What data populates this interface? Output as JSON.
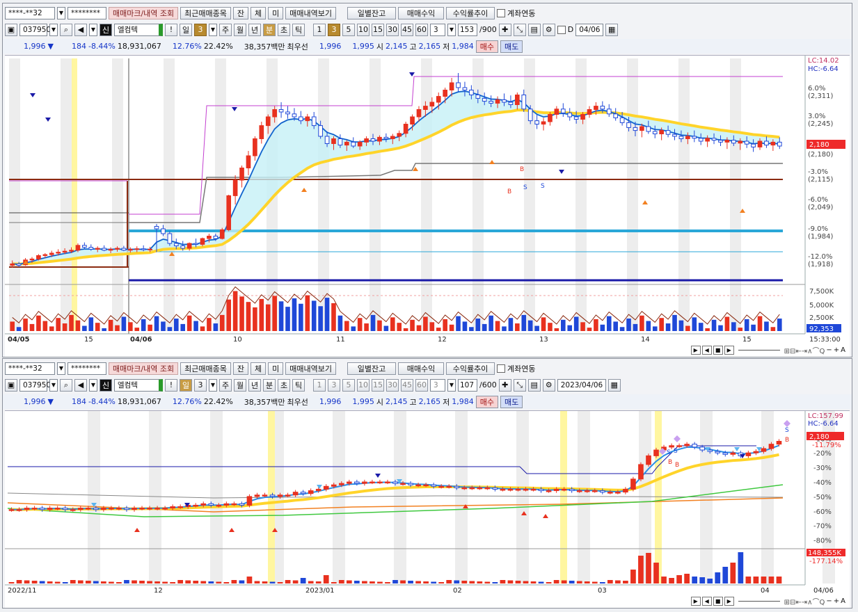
{
  "colors": {
    "up": "#e8311f",
    "down": "#1f48d8",
    "ma_yellow": "#ffd42a",
    "ma_blue": "#2a8fe6",
    "cloud": "#c6f0f6",
    "envelope": "#c33fd0",
    "pivot_cyan": "#2aa7d8",
    "navy": "#1a1aa8",
    "brown": "#8b2a10",
    "orange": "#f28020",
    "green": "#3fc83f",
    "gray": "#777777",
    "highlight": "#fff6a0",
    "price_tag": "#ee2a2a",
    "volume_tag": "#1f48d8"
  },
  "panel1": {
    "toolbar": {
      "account": "****-**32",
      "password": "********",
      "mark_btn": "매매마크/내역 조회",
      "recent_btn": "최근매매종목",
      "jan": "잔",
      "che": "체",
      "mi": "미",
      "history_btn": "매매내역보기",
      "daily_balance": "일별잔고",
      "trade_profit": "매매수익",
      "return_trend": "수익률추이",
      "link_account": "계좌연동"
    },
    "symbol_bar": {
      "code": "037950",
      "tag": "신",
      "name": "엘컴텍",
      "excl": "!",
      "periods": [
        "일",
        "3",
        "주",
        "월",
        "년",
        "분",
        "초",
        "틱"
      ],
      "intervals": [
        "1",
        "3",
        "5",
        "10",
        "15",
        "30",
        "45",
        "60"
      ],
      "interval_value": "3",
      "count": "153",
      "count_max": "/900",
      "d_label": "D",
      "date": "04/06"
    },
    "quote": {
      "price": "1,996",
      "change": "184",
      "rate": "-8.44%",
      "volume": "18,931,067",
      "turnover1": "12.76%",
      "turnover2": "22.42%",
      "amount": "38,357백만",
      "best_label": "최우선",
      "ask": "1,996",
      "bid": "1,995",
      "open_label": "시",
      "open": "2,145",
      "high_label": "고",
      "high": "2,165",
      "low_label": "저",
      "low": "1,984",
      "buy": "매수",
      "sell": "매도"
    },
    "axis": {
      "lc": "LC:14.02",
      "hc": "HC:-6.64",
      "price_labels": [
        {
          "pct": "6.0%",
          "price": "(2,311)"
        },
        {
          "pct": "3.0%",
          "price": "(2,245)"
        },
        {
          "pct": "-3.0%",
          "price": "(2,115)"
        },
        {
          "pct": "-6.0%",
          "price": "(2,049)"
        },
        {
          "pct": "-9.0%",
          "price": "(1,984)"
        },
        {
          "pct": "-12.0%",
          "price": "(1,918)"
        }
      ],
      "current_price": "2,180",
      "current_price2": "(2,180)",
      "volume_labels": [
        "7,500K",
        "5,000K",
        "2,500K"
      ],
      "current_volume": "92,353",
      "time_label": "15:33:00",
      "x_labels": [
        "04/05",
        "15",
        "04/06",
        "10",
        "11",
        "12",
        "13",
        "14",
        "15"
      ]
    }
  },
  "panel2": {
    "toolbar": {
      "account": "****-**32",
      "password": "********",
      "mark_btn": "매매마크/내역 조회",
      "recent_btn": "최근매매종목",
      "jan": "잔",
      "che": "체",
      "mi": "미",
      "history_btn": "매매내역보기",
      "daily_balance": "일별잔고",
      "trade_profit": "매매수익",
      "return_trend": "수익률추이",
      "link_account": "계좌연동"
    },
    "symbol_bar": {
      "code": "037950",
      "tag": "신",
      "name": "엘컴텍",
      "excl": "!",
      "periods": [
        "일",
        "3",
        "주",
        "월",
        "년",
        "분",
        "초",
        "틱"
      ],
      "intervals": [
        "1",
        "3",
        "5",
        "10",
        "15",
        "30",
        "45",
        "60"
      ],
      "interval_value": "3",
      "count": "107",
      "count_max": "/600",
      "date": "2023/04/06"
    },
    "quote": {
      "price": "1,996",
      "change": "184",
      "rate": "-8.44%",
      "volume": "18,931,067",
      "turnover1": "12.76%",
      "turnover2": "22.42%",
      "amount": "38,357백만",
      "best_label": "최우선",
      "ask": "1,996",
      "bid": "1,995",
      "open_label": "시",
      "open": "2,145",
      "high_label": "고",
      "high": "2,165",
      "low_label": "저",
      "low": "1,984",
      "buy": "매수",
      "sell": "매도"
    },
    "axis": {
      "lc": "LC:157.99",
      "hc": "HC:-6.64",
      "pct_labels": [
        "-10%",
        "-20%",
        "-30%",
        "-40%",
        "-50%",
        "-60%",
        "-70%",
        "-80%"
      ],
      "current_price": "2,180",
      "current_pct": "-11.79%",
      "current_volume": "148,355K",
      "volume_pct": "-177.14%",
      "x_labels": [
        "2022/11",
        "12",
        "2023/01",
        "02",
        "03",
        "04",
        "04/06"
      ]
    }
  },
  "chart_data": [
    {
      "type": "candlestick",
      "title": "엘컴텍 3분봉",
      "period": "3-minute",
      "x_labels": [
        "04/05",
        "15",
        "04/06",
        "10",
        "11",
        "12",
        "13",
        "14",
        "15"
      ],
      "price_range": [
        1900,
        2360
      ],
      "ohlc": [
        [
          1935,
          1945,
          1930,
          1938
        ],
        [
          1938,
          1942,
          1932,
          1935
        ],
        [
          1936,
          1950,
          1934,
          1946
        ],
        [
          1946,
          1952,
          1940,
          1948
        ],
        [
          1948,
          1958,
          1945,
          1955
        ],
        [
          1955,
          1960,
          1950,
          1957
        ],
        [
          1957,
          1965,
          1952,
          1960
        ],
        [
          1960,
          1968,
          1955,
          1962
        ],
        [
          1962,
          1970,
          1958,
          1964
        ],
        [
          1964,
          1972,
          1960,
          1966
        ],
        [
          1966,
          1980,
          1962,
          1976
        ],
        [
          1976,
          1982,
          1968,
          1972
        ],
        [
          1972,
          1978,
          1965,
          1968
        ],
        [
          1968,
          1974,
          1962,
          1970
        ],
        [
          1970,
          1976,
          1964,
          1966
        ],
        [
          1966,
          1972,
          1960,
          1968
        ],
        [
          1968,
          1974,
          1963,
          1970
        ],
        [
          1970,
          1975,
          1964,
          1966
        ],
        [
          1966,
          1972,
          1961,
          1968
        ],
        [
          1968,
          1974,
          1962,
          1969
        ],
        [
          1969,
          1976,
          1964,
          1967
        ],
        [
          1967,
          1973,
          1962,
          1968
        ],
        [
          2015,
          2020,
          1962,
          2010
        ],
        [
          2010,
          2018,
          1995,
          2000
        ],
        [
          2000,
          2005,
          1975,
          1980
        ],
        [
          1980,
          1990,
          1968,
          1975
        ],
        [
          1975,
          1985,
          1965,
          1970
        ],
        [
          1970,
          1982,
          1965,
          1980
        ],
        [
          1980,
          1990,
          1972,
          1978
        ],
        [
          1978,
          1992,
          1974,
          1990
        ],
        [
          1990,
          2000,
          1982,
          1995
        ],
        [
          1995,
          2000,
          1985,
          1990
        ],
        [
          1990,
          2012,
          1988,
          2008
        ],
        [
          2008,
          2080,
          2005,
          2078
        ],
        [
          2078,
          2120,
          2060,
          2110
        ],
        [
          2110,
          2140,
          2095,
          2135
        ],
        [
          2135,
          2170,
          2120,
          2160
        ],
        [
          2160,
          2200,
          2150,
          2195
        ],
        [
          2195,
          2230,
          2185,
          2222
        ],
        [
          2222,
          2245,
          2205,
          2240
        ],
        [
          2240,
          2262,
          2228,
          2255
        ],
        [
          2255,
          2270,
          2238,
          2250
        ],
        [
          2250,
          2262,
          2236,
          2246
        ],
        [
          2246,
          2258,
          2232,
          2240
        ],
        [
          2240,
          2252,
          2225,
          2232
        ],
        [
          2232,
          2246,
          2220,
          2240
        ],
        [
          2240,
          2250,
          2215,
          2222
        ],
        [
          2222,
          2232,
          2195,
          2200
        ],
        [
          2200,
          2210,
          2178,
          2185
        ],
        [
          2185,
          2200,
          2172,
          2195
        ],
        [
          2195,
          2204,
          2176,
          2182
        ],
        [
          2182,
          2192,
          2170,
          2188
        ],
        [
          2188,
          2198,
          2176,
          2180
        ],
        [
          2180,
          2192,
          2172,
          2188
        ],
        [
          2188,
          2200,
          2180,
          2195
        ],
        [
          2195,
          2205,
          2182,
          2190
        ],
        [
          2190,
          2202,
          2182,
          2198
        ],
        [
          2198,
          2206,
          2188,
          2195
        ],
        [
          2195,
          2205,
          2184,
          2200
        ],
        [
          2200,
          2212,
          2190,
          2206
        ],
        [
          2206,
          2230,
          2198,
          2225
        ],
        [
          2225,
          2245,
          2212,
          2240
        ],
        [
          2240,
          2262,
          2230,
          2255
        ],
        [
          2255,
          2272,
          2240,
          2262
        ],
        [
          2262,
          2280,
          2248,
          2270
        ],
        [
          2270,
          2290,
          2255,
          2282
        ],
        [
          2282,
          2300,
          2268,
          2295
        ],
        [
          2295,
          2320,
          2282,
          2310
        ],
        [
          2310,
          2330,
          2290,
          2300
        ],
        [
          2300,
          2312,
          2282,
          2295
        ],
        [
          2295,
          2305,
          2276,
          2285
        ],
        [
          2285,
          2296,
          2268,
          2278
        ],
        [
          2278,
          2290,
          2264,
          2272
        ],
        [
          2272,
          2284,
          2260,
          2268
        ],
        [
          2268,
          2282,
          2258,
          2275
        ],
        [
          2275,
          2288,
          2262,
          2270
        ],
        [
          2270,
          2284,
          2258,
          2265
        ],
        [
          2265,
          2290,
          2255,
          2285
        ],
        [
          2285,
          2296,
          2250,
          2256
        ],
        [
          2256,
          2264,
          2225,
          2232
        ],
        [
          2232,
          2244,
          2215,
          2225
        ],
        [
          2225,
          2238,
          2212,
          2230
        ],
        [
          2230,
          2250,
          2222,
          2245
        ],
        [
          2245,
          2262,
          2236,
          2256
        ],
        [
          2256,
          2268,
          2240,
          2248
        ],
        [
          2248,
          2258,
          2232,
          2240
        ],
        [
          2240,
          2252,
          2226,
          2235
        ],
        [
          2235,
          2250,
          2225,
          2245
        ],
        [
          2245,
          2262,
          2238,
          2255
        ],
        [
          2255,
          2270,
          2244,
          2262
        ],
        [
          2262,
          2272,
          2248,
          2256
        ],
        [
          2256,
          2266,
          2240,
          2246
        ],
        [
          2246,
          2258,
          2232,
          2238
        ],
        [
          2238,
          2250,
          2222,
          2228
        ],
        [
          2228,
          2240,
          2210,
          2218
        ],
        [
          2218,
          2230,
          2200,
          2212
        ],
        [
          2212,
          2226,
          2198,
          2220
        ],
        [
          2220,
          2232,
          2205,
          2210
        ],
        [
          2210,
          2222,
          2196,
          2205
        ],
        [
          2205,
          2218,
          2192,
          2212
        ],
        [
          2212,
          2222,
          2198,
          2204
        ],
        [
          2204,
          2215,
          2192,
          2200
        ],
        [
          2200,
          2212,
          2188,
          2195
        ],
        [
          2195,
          2208,
          2184,
          2200
        ],
        [
          2200,
          2212,
          2188,
          2196
        ],
        [
          2196,
          2206,
          2182,
          2190
        ],
        [
          2190,
          2202,
          2178,
          2196
        ],
        [
          2196,
          2206,
          2184,
          2192
        ],
        [
          2192,
          2202,
          2180,
          2188
        ],
        [
          2188,
          2198,
          2174,
          2192
        ],
        [
          2192,
          2202,
          2180,
          2186
        ],
        [
          2186,
          2196,
          2172,
          2190
        ],
        [
          2190,
          2200,
          2176,
          2184
        ],
        [
          2184,
          2194,
          2168,
          2178
        ],
        [
          2178,
          2196,
          2172,
          2190
        ],
        [
          2190,
          2200,
          2176,
          2182
        ],
        [
          2182,
          2194,
          2170,
          2188
        ],
        [
          2188,
          2198,
          2174,
          2180
        ]
      ],
      "volume_max": 9000
    },
    {
      "type": "candlestick",
      "title": "엘컴텍 일봉",
      "period": "daily",
      "x_labels": [
        "2022/11",
        "12",
        "2023/01",
        "02",
        "03",
        "04",
        "04/06"
      ],
      "pct_range": [
        -85,
        5
      ],
      "closes_pct": [
        -59,
        -59,
        -58,
        -58,
        -59,
        -58,
        -58,
        -59,
        -59,
        -58,
        -58,
        -59,
        -58,
        -58,
        -58,
        -59,
        -58,
        -58,
        -58,
        -58,
        -58,
        -57,
        -57,
        -56,
        -56,
        -55,
        -56,
        -56,
        -55,
        -55,
        -56,
        -50,
        -49,
        -49,
        -50,
        -49,
        -49,
        -47,
        -48,
        -46,
        -45,
        -43,
        -42,
        -41,
        -40,
        -41,
        -40,
        -40,
        -40,
        -40,
        -41,
        -41,
        -42,
        -42,
        -42,
        -43,
        -43,
        -43,
        -44,
        -44,
        -44,
        -44,
        -44,
        -45,
        -45,
        -45,
        -45,
        -45,
        -45,
        -46,
        -46,
        -45,
        -45,
        -46,
        -46,
        -46,
        -46,
        -47,
        -47,
        -47,
        -45,
        -38,
        -28,
        -22,
        -18,
        -16,
        -15,
        -15,
        -14,
        -16,
        -18,
        -19,
        -20,
        -21,
        -20,
        -22,
        -20,
        -19,
        -17,
        -14,
        -12
      ],
      "volume_spikes": [
        0.1,
        0.9,
        0.85,
        1.0,
        0.7,
        0.4,
        0.3,
        0.5,
        0.55,
        0.8
      ]
    }
  ]
}
